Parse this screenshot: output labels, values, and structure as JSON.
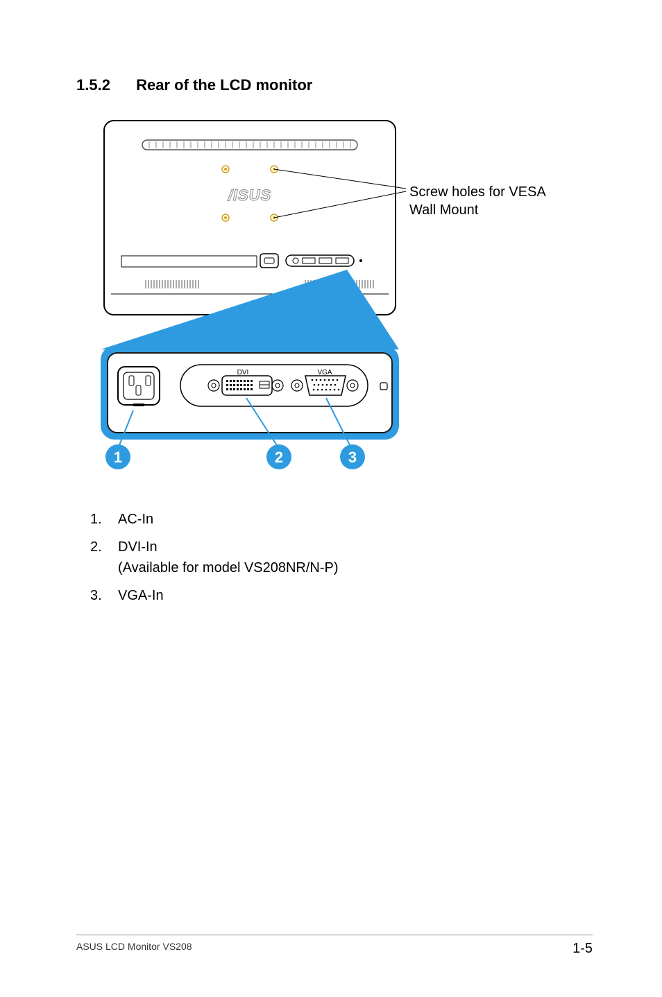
{
  "heading": {
    "number": "1.5.2",
    "title": "Rear of the LCD monitor"
  },
  "callout": {
    "line1": "Screw holes for VESA",
    "line2": "Wall Mount"
  },
  "diagram": {
    "port_dvi_label": "DVI",
    "port_vga_label": "VGA",
    "badge1": "1",
    "badge2": "2",
    "badge3": "3"
  },
  "list": {
    "items": [
      {
        "num": "1.",
        "label": "AC-In",
        "sub": ""
      },
      {
        "num": "2.",
        "label": "DVI-In",
        "sub": "(Available for model VS208NR/N-P)"
      },
      {
        "num": "3.",
        "label": "VGA-In",
        "sub": ""
      }
    ]
  },
  "footer": {
    "left": "ASUS LCD Monitor VS208",
    "right": "1-5"
  }
}
